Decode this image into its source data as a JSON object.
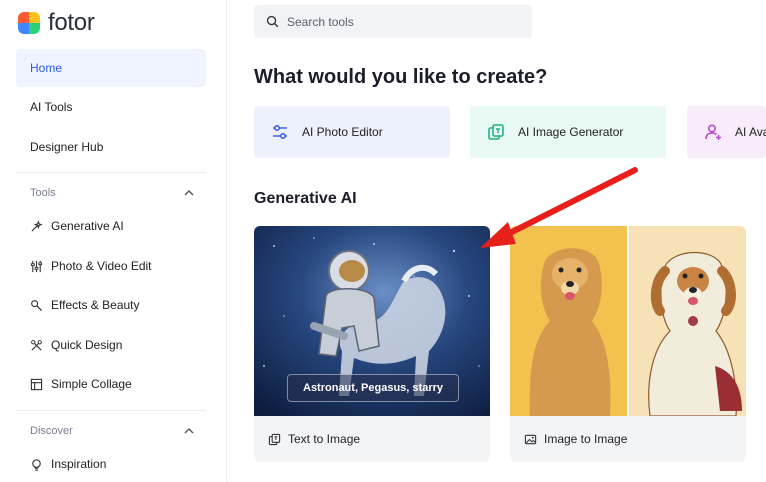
{
  "brand": {
    "name": "fotor"
  },
  "nav": {
    "items": [
      {
        "label": "Home",
        "active": true
      },
      {
        "label": "AI Tools"
      },
      {
        "label": "Designer Hub"
      }
    ]
  },
  "tools_section": {
    "label": "Tools",
    "items": [
      {
        "label": "Generative AI",
        "icon": "sparkle-icon"
      },
      {
        "label": "Photo & Video Edit",
        "icon": "sliders-icon"
      },
      {
        "label": "Effects & Beauty",
        "icon": "wand-icon"
      },
      {
        "label": "Quick Design",
        "icon": "design-icon"
      },
      {
        "label": "Simple Collage",
        "icon": "collage-icon"
      }
    ]
  },
  "discover_section": {
    "label": "Discover",
    "items": [
      {
        "label": "Inspiration",
        "icon": "bulb-icon"
      }
    ]
  },
  "search": {
    "placeholder": "Search tools"
  },
  "main": {
    "title": "What would you like to create?",
    "quick_actions": [
      {
        "label": "AI Photo Editor",
        "bg": "#edf1fd",
        "icon_color": "#3d63e8"
      },
      {
        "label": "AI Image Generator",
        "bg": "#e8f8f3",
        "icon_color": "#1fb38a"
      },
      {
        "label": "AI Ava",
        "bg": "#f8ecfb",
        "icon_color": "#b54bd1"
      }
    ],
    "section_title": "Generative AI",
    "cards": [
      {
        "label": "Text to Image",
        "prompt": "Astronaut, Pegasus, starry"
      },
      {
        "label": "Image to Image"
      }
    ]
  },
  "colors": {
    "accent": "#2c5bf0",
    "annotation_arrow": "#e8201c"
  }
}
